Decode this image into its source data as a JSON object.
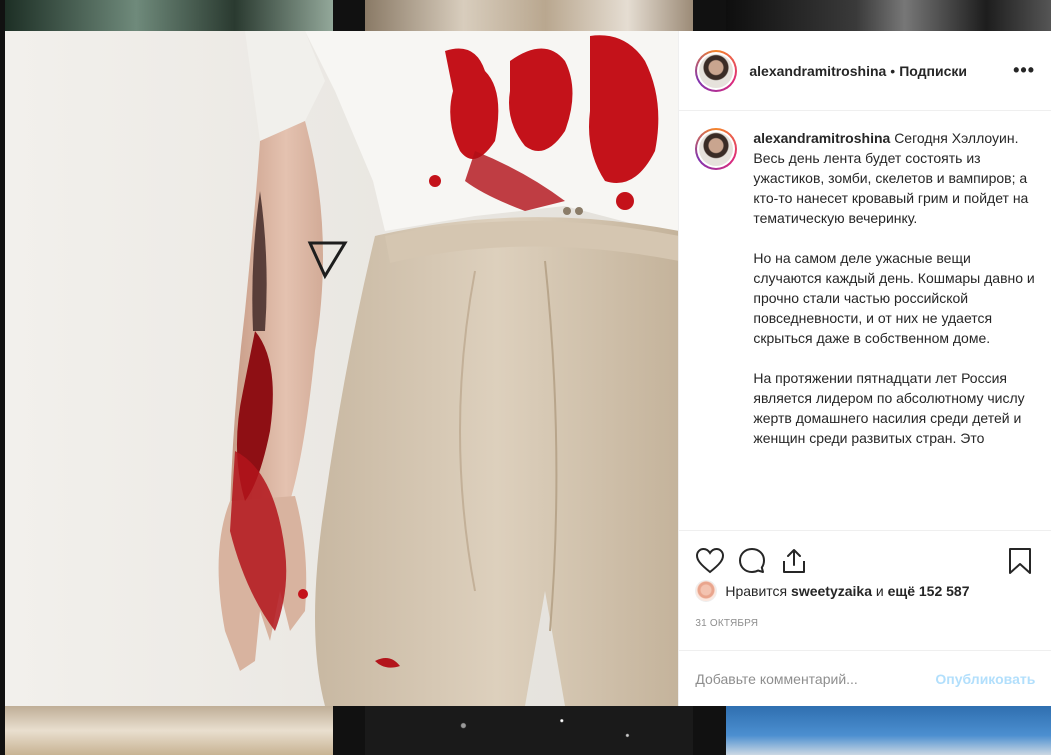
{
  "post": {
    "username": "alexandramitroshina",
    "separator": "•",
    "follow_label": "Подписки",
    "more_label": "•••"
  },
  "caption": {
    "username": "alexandramitroshina",
    "paragraphs": [
      "Сегодня Хэллоуин. Весь день лента будет состоять из ужастиков, зомби, скелетов и вампиров; а кто-то нанесет кровавый грим и пойдет на тематическую вечеринку.",
      "Но на самом деле ужасные вещи случаются каждый день. Кошмары давно и прочно стали частью российской повседневности, и от них не удается скрыться даже в собственном доме.",
      "На протяжении пятнадцати лет Россия является лидером по абсолютному числу жертв домашнего насилия среди детей и женщин среди развитых стран. Это"
    ]
  },
  "likes": {
    "prefix": "Нравится",
    "user": "sweetyzaika",
    "middle": "и",
    "count": "ещё 152 587"
  },
  "date": "31 октября",
  "comment": {
    "placeholder": "Добавьте комментарий...",
    "publish_label": "Опубликовать"
  },
  "icons": [
    "heart-icon",
    "comment-icon",
    "share-icon",
    "bookmark-icon",
    "more-icon"
  ],
  "colors": {
    "link_disabled": "#b2dffc",
    "blood": "#c4121a",
    "muted": "#8e8e8e"
  }
}
